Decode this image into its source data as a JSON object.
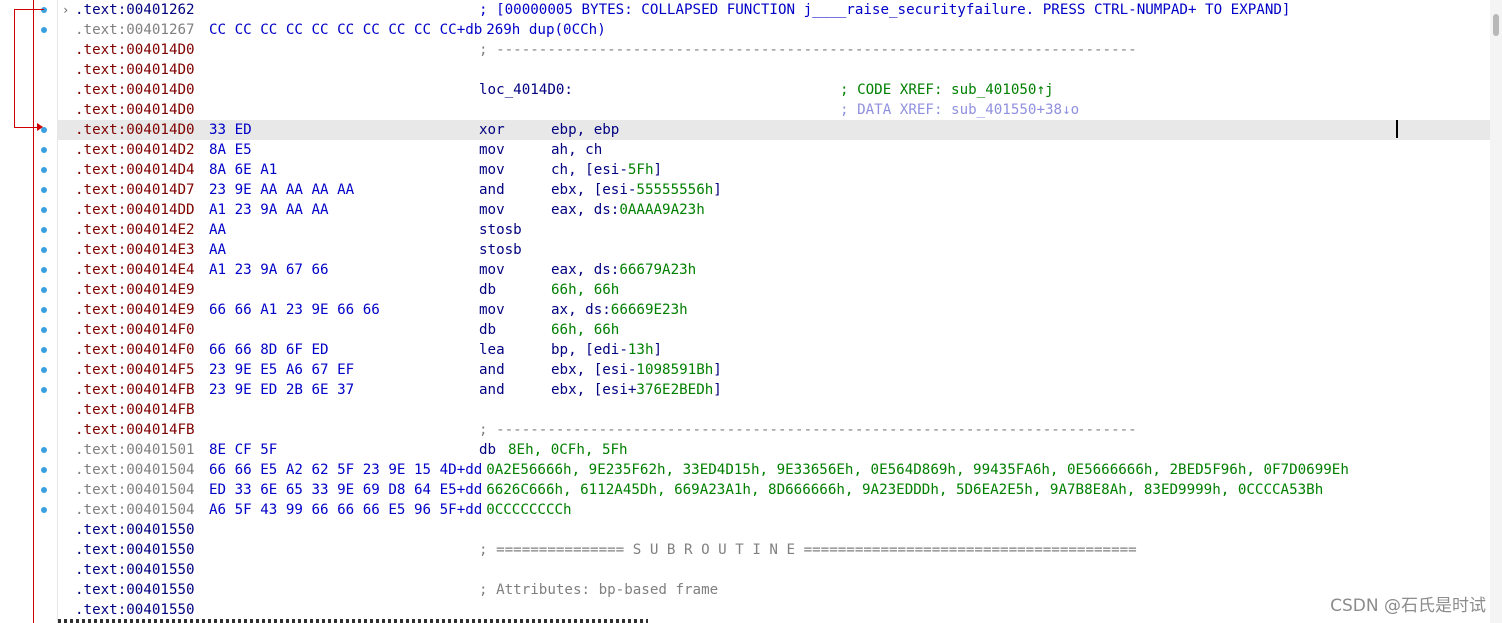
{
  "watermark": "CSDN @石氏是时试",
  "lines": [
    {
      "addr": ".text:00401262",
      "ac": "black",
      "comment": "; [00000005 BYTES: COLLAPSED FUNCTION j____raise_securityfailure. PRESS CTRL-NUMPAD+ TO EXPAND]",
      "cc": "blue",
      "expand": "›"
    },
    {
      "addr": ".text:00401267",
      "ac": "gray",
      "bytes": "CC CC CC CC CC CC CC CC CC CC+db",
      "ops_raw": "269h dup(0CCh)",
      "oc": "blue"
    },
    {
      "addr": ".text:004014D0",
      "ac": "red",
      "comment": "; ---------------------------------------------------------------------------",
      "cc": "gray"
    },
    {
      "addr": ".text:004014D0",
      "ac": "red"
    },
    {
      "addr": ".text:004014D0",
      "ac": "red",
      "label": "loc_4014D0:",
      "xref": "; CODE XREF: sub_401050↑j",
      "xc": "green"
    },
    {
      "addr": ".text:004014D0",
      "ac": "red",
      "xref": "; DATA XREF: sub_401550+38↓o",
      "xc": "lblue"
    },
    {
      "addr": ".text:004014D0",
      "ac": "red",
      "bytes": "33 ED",
      "mn": "xor",
      "ops": "ebp, ebp",
      "cur": true
    },
    {
      "addr": ".text:004014D2",
      "ac": "red",
      "bytes": "8A E5",
      "mn": "mov",
      "ops": "ah, ch"
    },
    {
      "addr": ".text:004014D4",
      "ac": "red",
      "bytes": "8A 6E A1",
      "mn": "mov",
      "ops": "ch, [esi-",
      "num": "5Fh",
      "tail": "]"
    },
    {
      "addr": ".text:004014D7",
      "ac": "red",
      "bytes": "23 9E AA AA AA AA",
      "mn": "and",
      "ops": "ebx, [esi-",
      "num": "55555556h",
      "tail": "]"
    },
    {
      "addr": ".text:004014DD",
      "ac": "red",
      "bytes": "A1 23 9A AA AA",
      "mn": "mov",
      "ops": "eax, ds:",
      "num": "0AAAA9A23h",
      "tail": ""
    },
    {
      "addr": ".text:004014E2",
      "ac": "red",
      "bytes": "AA",
      "mn": "stosb"
    },
    {
      "addr": ".text:004014E3",
      "ac": "red",
      "bytes": "AA",
      "mn": "stosb"
    },
    {
      "addr": ".text:004014E4",
      "ac": "red",
      "bytes": "A1 23 9A 67 66",
      "mn": "mov",
      "ops": "eax, ds:",
      "num": "66679A23h",
      "tail": ""
    },
    {
      "addr": ".text:004014E9",
      "ac": "red",
      "mn": "db",
      "ops": "",
      "num": "66h, 66h",
      "tail": ""
    },
    {
      "addr": ".text:004014E9",
      "ac": "red",
      "bytes": "66 66 A1 23 9E 66 66",
      "mn": "mov",
      "ops": "ax, ds:",
      "num": "66669E23h",
      "tail": ""
    },
    {
      "addr": ".text:004014F0",
      "ac": "red",
      "mn": "db",
      "ops": "",
      "num": "66h, 66h",
      "tail": ""
    },
    {
      "addr": ".text:004014F0",
      "ac": "red",
      "bytes": "66 66 8D 6F ED",
      "mn": "lea",
      "ops": "bp, [edi-",
      "num": "13h",
      "tail": "]"
    },
    {
      "addr": ".text:004014F5",
      "ac": "red",
      "bytes": "23 9E E5 A6 67 EF",
      "mn": "and",
      "ops": "ebx, [esi-",
      "num": "1098591Bh",
      "tail": "]"
    },
    {
      "addr": ".text:004014FB",
      "ac": "red",
      "bytes": "23 9E ED 2B 6E 37",
      "mn": "and",
      "ops": "ebx, [esi+",
      "num": "376E2BEDh",
      "tail": "]"
    },
    {
      "addr": ".text:004014FB",
      "ac": "red"
    },
    {
      "addr": ".text:004014FB",
      "ac": "red",
      "comment": "; ---------------------------------------------------------------------------",
      "cc": "gray"
    },
    {
      "addr": ".text:00401501",
      "ac": "gray",
      "bytes": "8E CF 5F",
      "mn": "db",
      "ops": "",
      "num": "8Eh, 0CFh, 5Fh",
      "tail": "",
      "mnleft": "raw"
    },
    {
      "addr": ".text:00401504",
      "ac": "gray",
      "bytes": "66 66 E5 A2 62 5F 23 9E 15 4D+dd",
      "ops_raw": "0A2E56666h, 9E235F62h, 33ED4D15h, 9E33656Eh, 0E564D869h, 99435FA6h, 0E5666666h, 2BED5F96h, 0F7D0699Eh",
      "oc": "green"
    },
    {
      "addr": ".text:00401504",
      "ac": "gray",
      "bytes": "ED 33 6E 65 33 9E 69 D8 64 E5+dd",
      "ops_raw": "6626C666h, 6112A45Dh, 669A23A1h, 8D666666h, 9A23EDDDh, 5D6EA2E5h, 9A7B8E8Ah, 83ED9999h, 0CCCCA53Bh",
      "oc": "green"
    },
    {
      "addr": ".text:00401504",
      "ac": "gray",
      "bytes": "A6 5F 43 99 66 66 66 E5 96 5F+dd",
      "ops_raw": "0CCCCCCCCh",
      "oc": "green"
    },
    {
      "addr": ".text:00401550",
      "ac": "black"
    },
    {
      "addr": ".text:00401550",
      "ac": "black",
      "comment": "; =============== S U B R O U T I N E =======================================",
      "cc": "gray"
    },
    {
      "addr": ".text:00401550",
      "ac": "black"
    },
    {
      "addr": ".text:00401550",
      "ac": "black",
      "comment": "; Attributes: bp-based frame",
      "cc": "gray"
    },
    {
      "addr": ".text:00401550",
      "ac": "black"
    }
  ]
}
